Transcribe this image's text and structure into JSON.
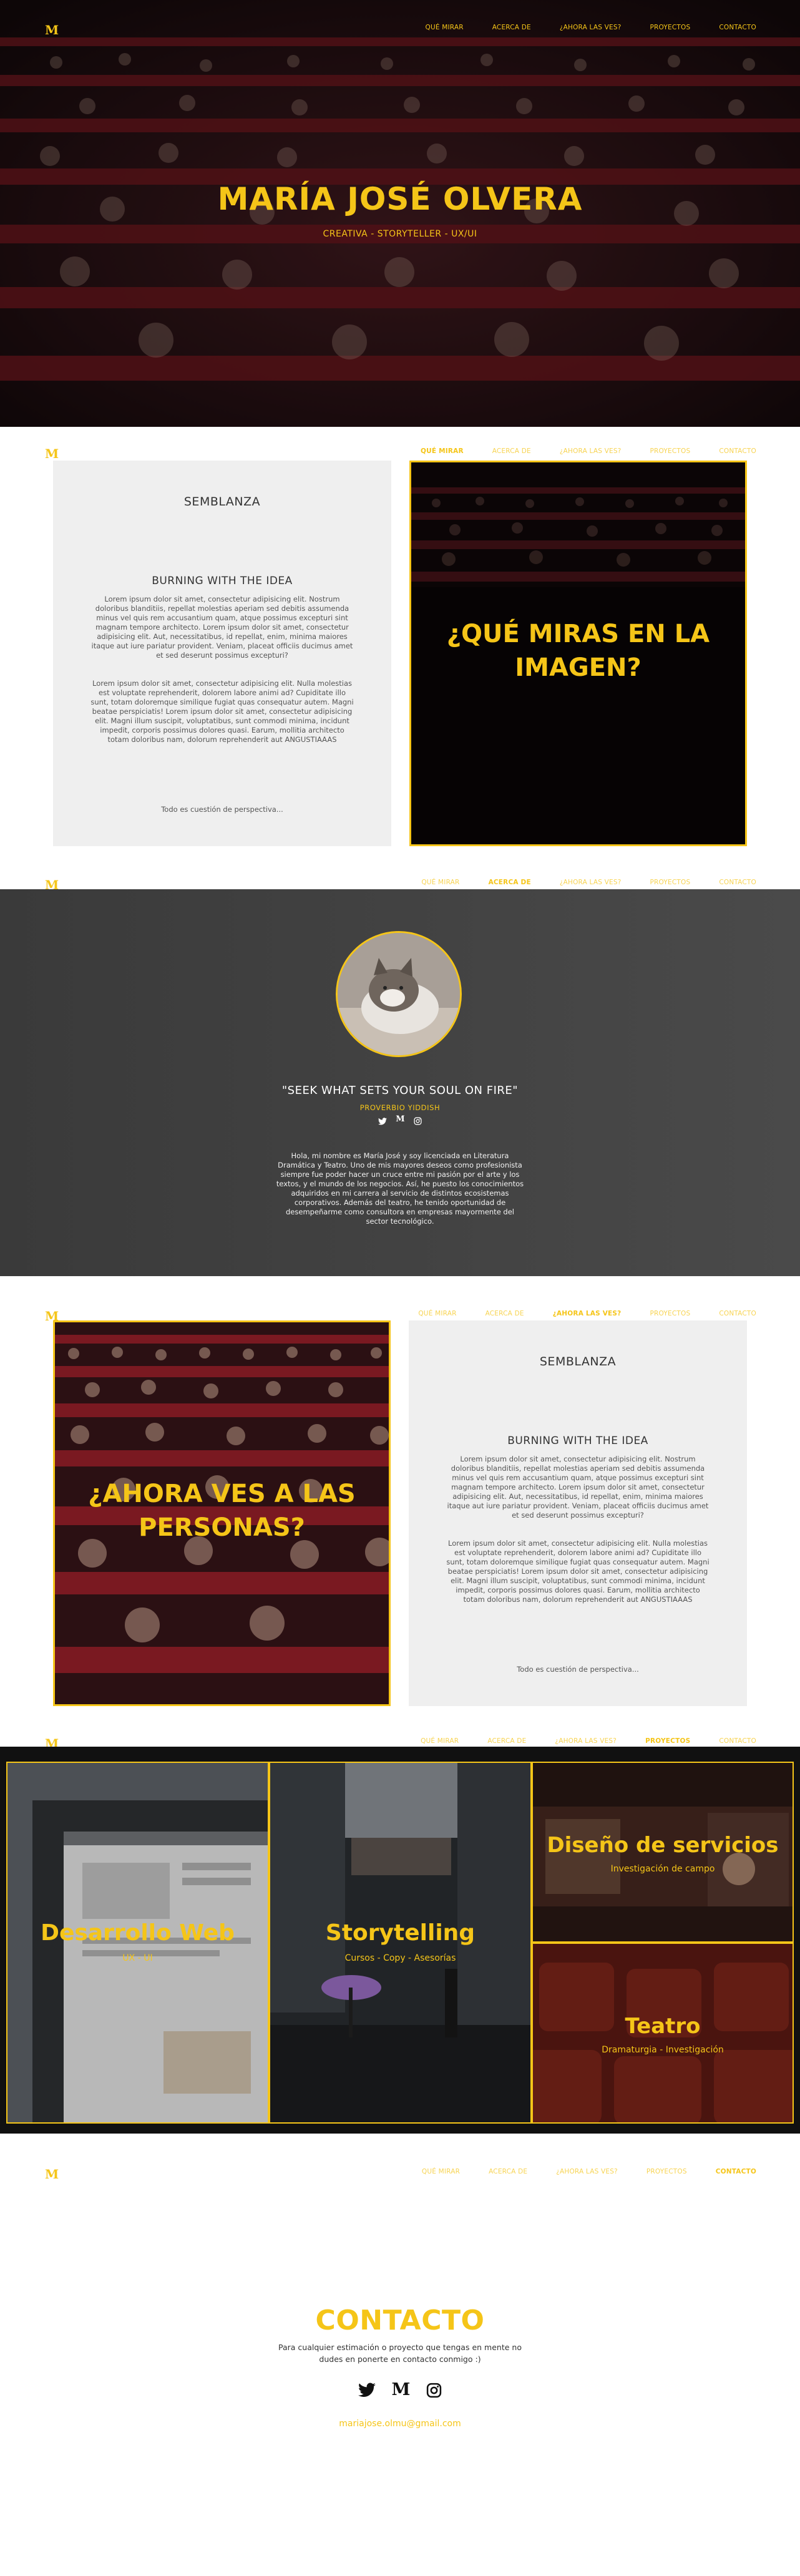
{
  "brand": {
    "logo": "M",
    "accent": "#F5C518"
  },
  "nav": {
    "items": [
      "QUÉ MIRAR",
      "ACERCA DE",
      "¿AHORA LAS VES?",
      "PROYECTOS",
      "CONTACTO"
    ]
  },
  "hero": {
    "title": "MARÍA JOSÉ OLVERA",
    "subtitle": "CREATIVA - STORYTELLER - UX/UI"
  },
  "que_mirar": {
    "card_title": "SEMBLANZA",
    "card_subtitle": "BURNING WITH THE IDEA",
    "paragraph1": "Lorem ipsum dolor sit amet, consectetur adipisicing elit. Nostrum doloribus blanditiis, repellat molestias aperiam sed debitis assumenda minus vel quis rem accusantium quam, atque possimus excepturi sint magnam tempore architecto. Lorem ipsum dolor sit amet, consectetur adipisicing elit. Aut, necessitatibus, id repellat, enim, minima maiores itaque aut iure pariatur provident. Veniam, placeat officiis ducimus amet et sed deserunt possimus excepturi?",
    "paragraph2": "Lorem ipsum dolor sit amet, consectetur adipisicing elit. Nulla molestias est voluptate reprehenderit, dolorem labore animi ad? Cupiditate illo sunt, totam doloremque similique fugiat quas consequatur autem. Magni beatae perspiciatis! Lorem ipsum dolor sit amet, consectetur adipisicing elit. Magni illum suscipit, voluptatibus, sunt commodi minima, incidunt impedit, corporis possimus dolores quasi. Earum, mollitia architecto totam doloribus nam, dolorum reprehenderit aut ANGUSTIAAAS",
    "card_footer": "Todo es cuestión de perspectiva...",
    "image_title": "¿QUÉ MIRAS EN LA IMAGEN?"
  },
  "acerca": {
    "quote": "\"SEEK WHAT SETS YOUR SOUL ON FIRE\"",
    "quote_author": "PROVERBIO YIDDISH",
    "bio": "Hola, mi nombre es María José y soy licenciada en Literatura Dramática y Teatro. Uno de mis mayores deseos como profesionista siempre fue poder hacer un cruce entre mi pasión por el arte y los textos, y el mundo de los negocios. Así, he puesto los conocimientos adquiridos en mi carrera al servicio de distintos ecosistemas corporativos. Además del teatro, he tenido oportunidad de desempeñarme como consultora en empresas mayormente del sector tecnológico."
  },
  "ahora": {
    "image_title": "¿AHORA VES A LAS PERSONAS?",
    "card_title": "SEMBLANZA",
    "card_subtitle": "BURNING WITH THE IDEA",
    "paragraph1": "Lorem ipsum dolor sit amet, consectetur adipisicing elit. Nostrum doloribus blanditiis, repellat molestias aperiam sed debitis assumenda minus vel quis rem accusantium quam, atque possimus excepturi sint magnam tempore architecto. Lorem ipsum dolor sit amet, consectetur adipisicing elit. Aut, necessitatibus, id repellat, enim, minima maiores itaque aut iure pariatur provident. Veniam, placeat officiis ducimus amet et sed deserunt possimus excepturi?",
    "paragraph2": "Lorem ipsum dolor sit amet, consectetur adipisicing elit. Nulla molestias est voluptate reprehenderit, dolorem labore animi ad? Cupiditate illo sunt, totam doloremque similique fugiat quas consequatur autem. Magni beatae perspiciatis! Lorem ipsum dolor sit amet, consectetur adipisicing elit. Magni illum suscipit, voluptatibus, sunt commodi minima, incidunt impedit, corporis possimus dolores quasi. Earum, mollitia architecto totam doloribus nam, dolorum reprehenderit aut ANGUSTIAAAS",
    "card_footer": "Todo es cuestión de perspectiva..."
  },
  "proyectos": {
    "web": {
      "title": "Desarrollo Web",
      "subtitle": "UX - UI"
    },
    "story": {
      "title": "Storytelling",
      "subtitle": "Cursos - Copy - Asesorías"
    },
    "servicios": {
      "title": "Diseño de servicios",
      "subtitle": "Investigación de campo"
    },
    "teatro": {
      "title": "Teatro",
      "subtitle": "Dramaturgia - Investigación"
    }
  },
  "contacto": {
    "title": "CONTACTO",
    "text": "Para cualquier estimación o proyecto que tengas en mente no dudes en ponerte en contacto conmigo :)",
    "email": "mariajose.olmu@gmail.com"
  },
  "icons": [
    "twitter-icon",
    "medium-icon",
    "instagram-icon"
  ]
}
